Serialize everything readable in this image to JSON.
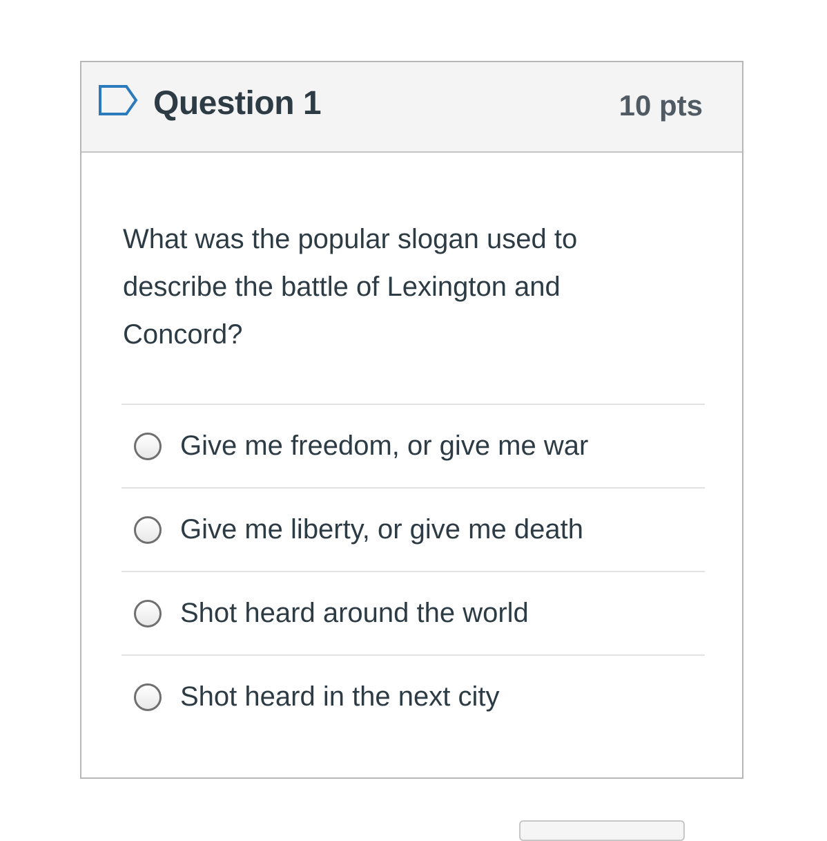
{
  "question": {
    "title": "Question 1",
    "points": "10 pts",
    "flag_icon": "flag-outline-icon",
    "text": "What was the popular slogan used to describe the battle of Lexington and Concord?"
  },
  "answers": [
    {
      "label": "Give me freedom, or give me war",
      "selected": false
    },
    {
      "label": "Give me liberty, or give me death",
      "selected": false
    },
    {
      "label": "Shot heard around the world",
      "selected": false
    },
    {
      "label": "Shot heard in the next city",
      "selected": false
    }
  ],
  "colors": {
    "text": "#2d3b45",
    "header_bg": "#f4f4f4",
    "border": "#b7b7b7",
    "flag": "#2b7abc"
  }
}
